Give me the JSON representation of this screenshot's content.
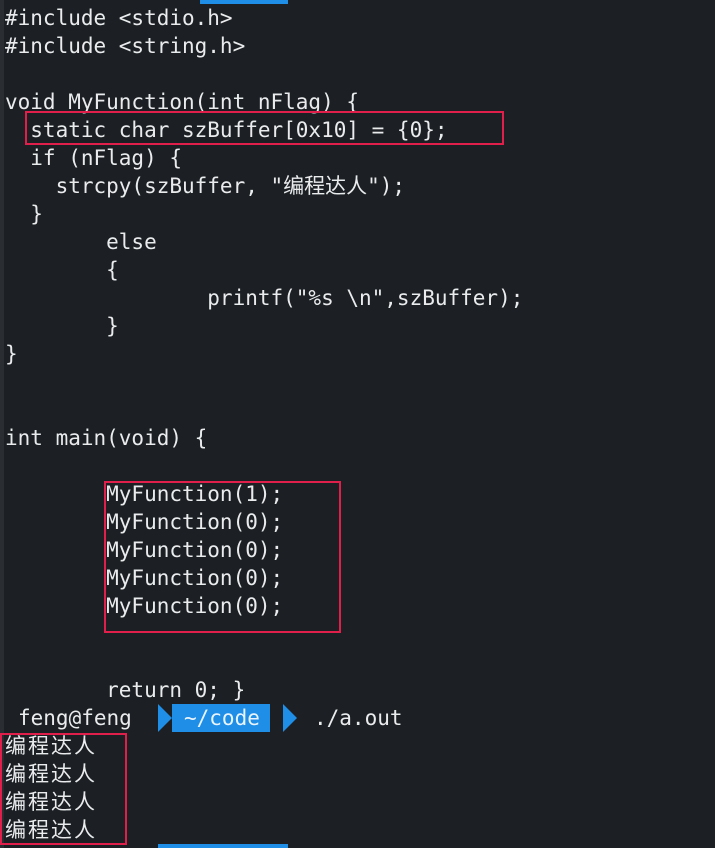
{
  "code_lines": [
    "#include <stdio.h>",
    "#include <string.h>",
    "",
    "void MyFunction(int nFlag) {",
    "  static char szBuffer[0x10] = {0};",
    "  if (nFlag) {",
    "    strcpy(szBuffer, \"编程达人\");",
    "  }",
    "        else",
    "        {",
    "                printf(\"%s \\n\",szBuffer);",
    "        }",
    "}",
    "",
    "",
    "int main(void) {",
    "",
    "        MyFunction(1);",
    "        MyFunction(0);",
    "        MyFunction(0);",
    "        MyFunction(0);",
    "        MyFunction(0);",
    "",
    "",
    "        return 0; }"
  ],
  "prompt": {
    "user": "feng@feng",
    "dir": "~/code",
    "command": "./a.out"
  },
  "output_lines": [
    "编程达人",
    "编程达人",
    "编程达人",
    "编程达人"
  ],
  "colors": {
    "background": "#1c1f23",
    "text": "#e9ebed",
    "highlight_box": "#e0204a",
    "prompt_segment": "#1e8ee6"
  }
}
